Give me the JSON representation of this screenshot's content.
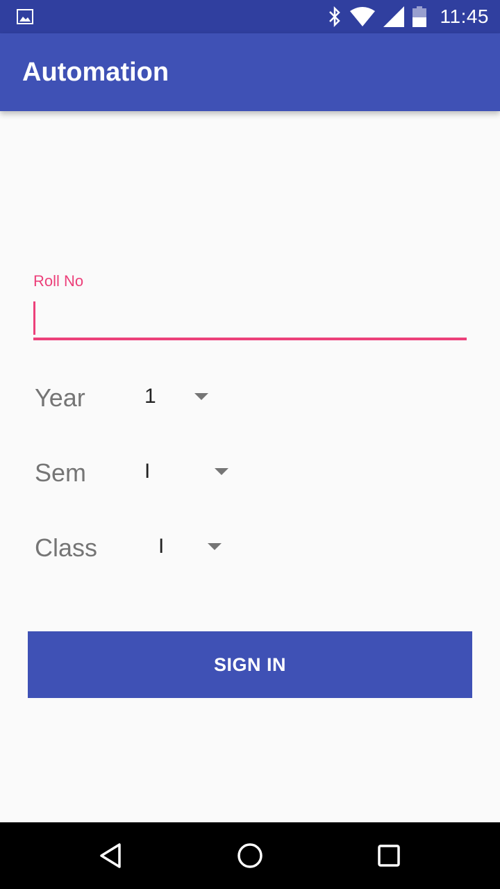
{
  "status_bar": {
    "time": "11:45",
    "left_icon": "image-notification-icon",
    "icons": [
      "bluetooth-icon",
      "wifi-icon",
      "signal-icon",
      "battery-icon"
    ]
  },
  "app_bar": {
    "title": "Automation"
  },
  "form": {
    "roll_no": {
      "label": "Roll No",
      "value": ""
    },
    "year": {
      "label": "Year",
      "selected": "1"
    },
    "sem": {
      "label": "Sem",
      "selected": "I"
    },
    "class": {
      "label": "Class",
      "selected": "I"
    },
    "submit_label": "SIGN IN"
  },
  "navigation": {
    "buttons": [
      "back-icon",
      "home-icon",
      "recents-icon"
    ]
  },
  "colors": {
    "status_bar": "#303f9f",
    "primary": "#3f51b5",
    "accent": "#ec407a",
    "background": "#fafafa"
  }
}
